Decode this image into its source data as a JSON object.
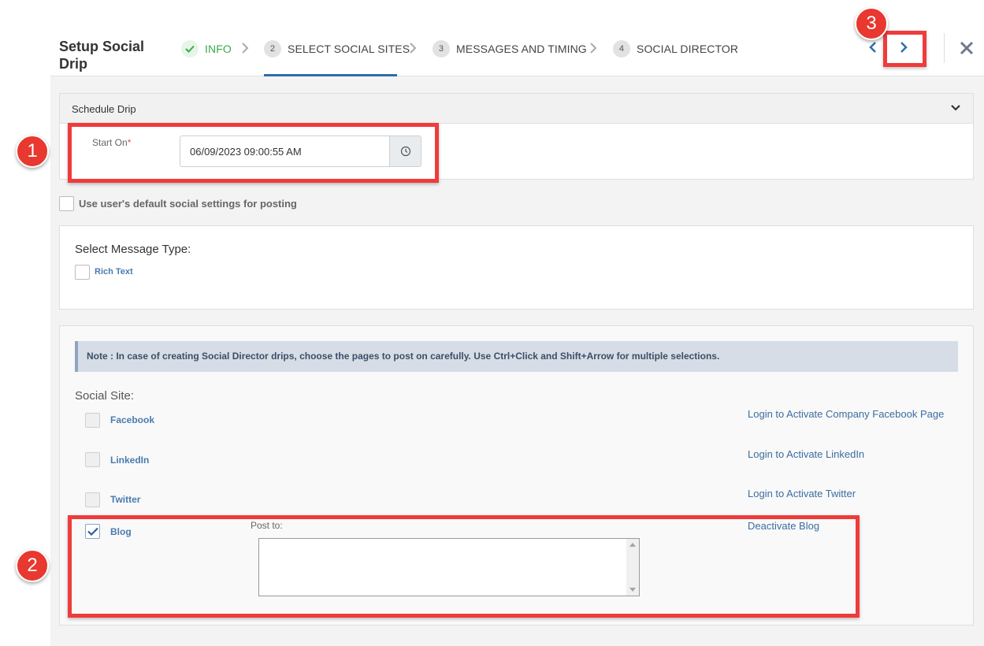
{
  "header": {
    "title": "Setup Social Drip",
    "steps": [
      {
        "num": "",
        "label": "INFO",
        "state": "done"
      },
      {
        "num": "2",
        "label": "SELECT SOCIAL SITES",
        "state": "active"
      },
      {
        "num": "3",
        "label": "MESSAGES AND TIMING",
        "state": "pending"
      },
      {
        "num": "4",
        "label": "SOCIAL DIRECTOR",
        "state": "pending"
      }
    ],
    "icons": {
      "prev": "chevron-left-icon",
      "next": "chevron-right-icon",
      "close": "close-icon"
    }
  },
  "schedule": {
    "section_title": "Schedule Drip",
    "start_label": "Start On",
    "required_mark": "*",
    "start_value": "06/09/2023 09:00:55 AM"
  },
  "default_settings_label": "Use user's default social settings for posting",
  "message_type": {
    "heading": "Select Message Type:",
    "rich_text_label": "Rich Text"
  },
  "social": {
    "note": "Note : In case of creating Social Director drips, choose the pages to post on carefully. Use Ctrl+Click and Shift+Arrow for multiple selections.",
    "heading": "Social Site:",
    "sites": [
      {
        "name": "Facebook",
        "action": "Login to Activate Company Facebook Page",
        "checked": false
      },
      {
        "name": "LinkedIn",
        "action": "Login to Activate LinkedIn",
        "checked": false
      },
      {
        "name": "Twitter",
        "action": "Login to Activate Twitter",
        "checked": false
      },
      {
        "name": "Blog",
        "action": "Deactivate Blog",
        "checked": true
      }
    ],
    "post_to_label": "Post to:"
  },
  "annotations": {
    "badge1": "1",
    "badge2": "2",
    "badge3": "3"
  },
  "colors": {
    "highlight": "#ef3b3b",
    "badge": "#e8382f",
    "success": "#3aaa48",
    "accent": "#2e6fa9"
  }
}
